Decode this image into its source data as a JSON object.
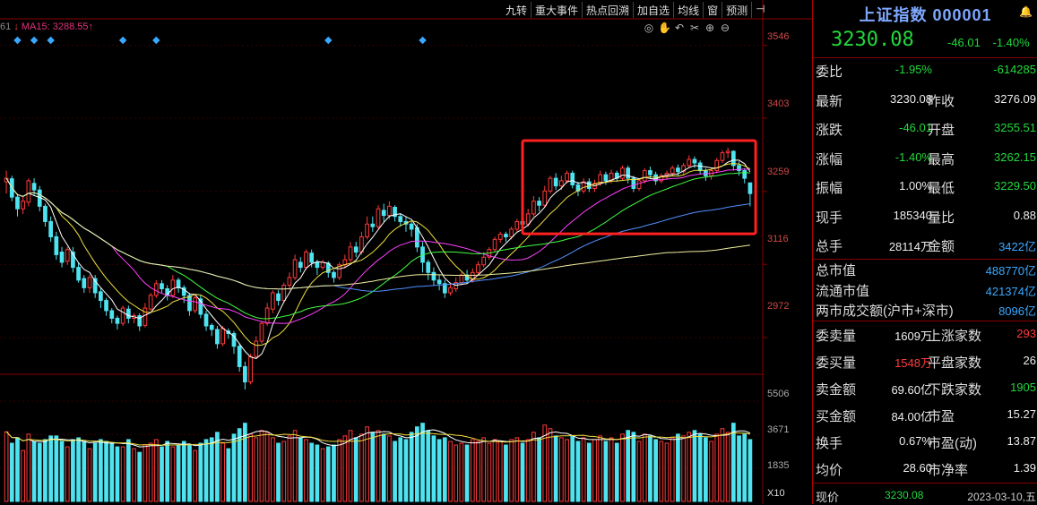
{
  "toolbar": [
    "九转",
    "重大事件",
    "热点回溯",
    "加自选",
    "均线",
    "窗",
    "预测",
    "⊣"
  ],
  "ma_legend": {
    "prefix": "61",
    "ma15": "MA15: 3288.55",
    "arrow": "↑"
  },
  "chart_tools": [
    "◎",
    "✋",
    "↶",
    "✂",
    "⊕",
    "⊖"
  ],
  "price_axis": [
    "3546",
    "3403",
    "3259",
    "3116",
    "2972"
  ],
  "volume_axis": [
    "5506",
    "3671",
    "1835"
  ],
  "volume_unit": "X10",
  "panel": {
    "name": "上证指数",
    "code": "000001",
    "price": "3230.08",
    "change": "-46.01",
    "change_pct": "-1.40%",
    "rows": [
      {
        "l1": "委比",
        "v1": "-1.95%",
        "c1": "g",
        "l2": "",
        "v2": "-614285",
        "c2": "g"
      },
      {
        "l1": "最新",
        "v1": "3230.08",
        "c1": "w",
        "l2": "昨收",
        "v2": "3276.09",
        "c2": "w"
      },
      {
        "l1": "涨跌",
        "v1": "-46.01",
        "c1": "g",
        "l2": "开盘",
        "v2": "3255.51",
        "c2": "g"
      },
      {
        "l1": "涨幅",
        "v1": "-1.40%",
        "c1": "g",
        "l2": "最高",
        "v2": "3262.15",
        "c2": "g"
      },
      {
        "l1": "振幅",
        "v1": "1.00%",
        "c1": "w",
        "l2": "最低",
        "v2": "3229.50",
        "c2": "g"
      },
      {
        "l1": "现手",
        "v1": "185340",
        "c1": "w",
        "l2": "量比",
        "v2": "0.88",
        "c2": "w"
      },
      {
        "l1": "总手",
        "v1": "28114万",
        "c1": "w",
        "l2": "金额",
        "v2": "3422亿",
        "c2": "b"
      }
    ],
    "market": [
      {
        "l": "总市值",
        "v": "488770亿"
      },
      {
        "l": "流通市值",
        "v": "421374亿"
      },
      {
        "l": "两市成交额(沪市+深市)",
        "v": "8096亿"
      }
    ],
    "rows2": [
      {
        "l1": "委卖量",
        "v1": "1609万",
        "c1": "w",
        "l2": "上涨家数",
        "v2": "293",
        "c2": "r"
      },
      {
        "l1": "委买量",
        "v1": "1548万",
        "c1": "r",
        "l2": "平盘家数",
        "v2": "26",
        "c2": "w"
      },
      {
        "l1": "卖金额",
        "v1": "69.60亿",
        "c1": "w",
        "l2": "下跌家数",
        "v2": "1905",
        "c2": "g"
      },
      {
        "l1": "买金额",
        "v1": "84.00亿",
        "c1": "w",
        "l2": "市盈",
        "v2": "15.27",
        "c2": "w"
      },
      {
        "l1": "换手",
        "v1": "0.67%",
        "c1": "w",
        "l2": "市盈(动)",
        "v2": "13.87",
        "c2": "w"
      },
      {
        "l1": "均价",
        "v1": "28.60",
        "c1": "w",
        "l2": "市净率",
        "v2": "1.39",
        "c2": "w"
      }
    ],
    "bottom": {
      "label": "现价",
      "price": "3230.08",
      "date": "2023-03-10,五"
    }
  },
  "chart_data": {
    "type": "candlestick",
    "y_axis_ticks": [
      3546,
      3403,
      3259,
      3116,
      2972
    ],
    "y_range": [
      2900,
      3600
    ],
    "volume_ticks": [
      5506,
      3671,
      1835
    ],
    "volume_range": [
      0,
      6400
    ],
    "candles": [
      [
        3278,
        3285,
        3255,
        3300,
        3830
      ],
      [
        3284,
        3248,
        3240,
        3290,
        3200
      ],
      [
        3248,
        3225,
        3210,
        3255,
        3500
      ],
      [
        3225,
        3240,
        3215,
        3250,
        2800
      ],
      [
        3238,
        3280,
        3230,
        3285,
        3700
      ],
      [
        3275,
        3262,
        3250,
        3285,
        3300
      ],
      [
        3262,
        3230,
        3220,
        3270,
        3200
      ],
      [
        3230,
        3200,
        3190,
        3235,
        3400
      ],
      [
        3200,
        3170,
        3160,
        3210,
        3600
      ],
      [
        3170,
        3135,
        3125,
        3180,
        3600
      ],
      [
        3140,
        3120,
        3110,
        3150,
        3300
      ],
      [
        3122,
        3145,
        3115,
        3150,
        3000
      ],
      [
        3140,
        3110,
        3100,
        3150,
        3400
      ],
      [
        3110,
        3085,
        3080,
        3120,
        3500
      ],
      [
        3088,
        3070,
        3060,
        3095,
        3300
      ],
      [
        3070,
        3090,
        3060,
        3095,
        2900
      ],
      [
        3088,
        3060,
        3050,
        3095,
        3200
      ],
      [
        3062,
        3045,
        3030,
        3070,
        3400
      ],
      [
        3045,
        3025,
        3015,
        3050,
        3300
      ],
      [
        3025,
        3010,
        3000,
        3030,
        3200
      ],
      [
        3010,
        3000,
        2988,
        3015,
        3000
      ],
      [
        3000,
        3030,
        2995,
        3035,
        3000
      ],
      [
        3028,
        3010,
        3000,
        3035,
        3400
      ],
      [
        3010,
        3015,
        3000,
        3020,
        2900
      ],
      [
        3015,
        2995,
        2985,
        3020,
        2700
      ],
      [
        2996,
        3030,
        2992,
        3040,
        3100
      ],
      [
        3028,
        3055,
        3025,
        3060,
        3200
      ],
      [
        3055,
        3078,
        3050,
        3085,
        3400
      ],
      [
        3078,
        3068,
        3060,
        3085,
        3000
      ],
      [
        3068,
        3055,
        3045,
        3075,
        3300
      ],
      [
        3055,
        3085,
        3050,
        3095,
        3000
      ],
      [
        3085,
        3070,
        3060,
        3090,
        3100
      ],
      [
        3070,
        3055,
        3040,
        3075,
        3300
      ],
      [
        3055,
        3025,
        3015,
        3060,
        3100
      ],
      [
        3025,
        3050,
        3020,
        3055,
        2800
      ],
      [
        3048,
        3018,
        3010,
        3055,
        3200
      ],
      [
        3018,
        2995,
        2985,
        3025,
        3400
      ],
      [
        2996,
        2988,
        2975,
        3000,
        3500
      ],
      [
        2988,
        2960,
        2950,
        2995,
        3800
      ],
      [
        2960,
        2990,
        2955,
        2995,
        3200
      ],
      [
        2985,
        2980,
        2970,
        2990,
        2900
      ],
      [
        2980,
        2955,
        2940,
        2985,
        3700
      ],
      [
        2955,
        2915,
        2905,
        2960,
        4000
      ],
      [
        2915,
        2885,
        2870,
        2925,
        4300
      ],
      [
        2885,
        2935,
        2880,
        2940,
        3700
      ],
      [
        2935,
        2965,
        2930,
        2975,
        3500
      ],
      [
        2965,
        3000,
        2960,
        3005,
        3900
      ],
      [
        3000,
        3030,
        2995,
        3040,
        3800
      ],
      [
        3028,
        3060,
        3020,
        3065,
        3500
      ],
      [
        3058,
        3045,
        3035,
        3065,
        3200
      ],
      [
        3045,
        3075,
        3040,
        3080,
        3300
      ],
      [
        3075,
        3090,
        3065,
        3100,
        3600
      ],
      [
        3090,
        3125,
        3085,
        3135,
        3900
      ],
      [
        3120,
        3110,
        3100,
        3130,
        3500
      ],
      [
        3110,
        3140,
        3105,
        3145,
        3400
      ],
      [
        3138,
        3120,
        3110,
        3145,
        3200
      ],
      [
        3120,
        3110,
        3095,
        3125,
        3100
      ],
      [
        3110,
        3120,
        3105,
        3125,
        2900
      ],
      [
        3118,
        3100,
        3090,
        3122,
        3000
      ],
      [
        3100,
        3090,
        3080,
        3105,
        3100
      ],
      [
        3090,
        3115,
        3085,
        3120,
        3400
      ],
      [
        3115,
        3125,
        3108,
        3135,
        3600
      ],
      [
        3125,
        3150,
        3120,
        3160,
        3900
      ],
      [
        3150,
        3140,
        3130,
        3160,
        3500
      ],
      [
        3140,
        3170,
        3135,
        3180,
        3700
      ],
      [
        3170,
        3195,
        3165,
        3210,
        4100
      ],
      [
        3195,
        3190,
        3180,
        3210,
        3800
      ],
      [
        3190,
        3225,
        3185,
        3232,
        3900
      ],
      [
        3222,
        3212,
        3200,
        3235,
        3700
      ],
      [
        3212,
        3230,
        3205,
        3240,
        3600
      ],
      [
        3228,
        3210,
        3200,
        3232,
        3300
      ],
      [
        3210,
        3200,
        3190,
        3215,
        3500
      ],
      [
        3200,
        3195,
        3180,
        3210,
        3400
      ],
      [
        3195,
        3185,
        3170,
        3200,
        3800
      ],
      [
        3188,
        3150,
        3140,
        3195,
        4100
      ],
      [
        3150,
        3120,
        3100,
        3160,
        4300
      ],
      [
        3120,
        3100,
        3085,
        3125,
        3900
      ],
      [
        3100,
        3085,
        3075,
        3110,
        3600
      ],
      [
        3085,
        3078,
        3065,
        3095,
        3400
      ],
      [
        3078,
        3060,
        3050,
        3085,
        3500
      ],
      [
        3060,
        3070,
        3055,
        3080,
        3300
      ],
      [
        3068,
        3080,
        3062,
        3090,
        3100
      ],
      [
        3080,
        3095,
        3075,
        3100,
        3200
      ],
      [
        3095,
        3085,
        3078,
        3105,
        3100
      ],
      [
        3085,
        3100,
        3080,
        3108,
        3400
      ],
      [
        3100,
        3115,
        3095,
        3122,
        3300
      ],
      [
        3115,
        3130,
        3110,
        3140,
        3500
      ],
      [
        3130,
        3145,
        3125,
        3150,
        3200
      ],
      [
        3145,
        3165,
        3140,
        3170,
        3400
      ],
      [
        3165,
        3175,
        3158,
        3180,
        3300
      ],
      [
        3175,
        3170,
        3160,
        3180,
        3100
      ],
      [
        3170,
        3185,
        3165,
        3190,
        3400
      ],
      [
        3185,
        3200,
        3180,
        3205,
        3500
      ],
      [
        3200,
        3195,
        3185,
        3205,
        3200
      ],
      [
        3195,
        3215,
        3190,
        3225,
        3400
      ],
      [
        3215,
        3240,
        3210,
        3250,
        3800
      ],
      [
        3240,
        3232,
        3220,
        3248,
        3500
      ],
      [
        3232,
        3260,
        3228,
        3270,
        4200
      ],
      [
        3260,
        3285,
        3255,
        3290,
        4000
      ],
      [
        3285,
        3270,
        3262,
        3295,
        3600
      ],
      [
        3270,
        3280,
        3262,
        3290,
        3500
      ],
      [
        3280,
        3295,
        3275,
        3300,
        3400
      ],
      [
        3295,
        3272,
        3265,
        3300,
        3600
      ],
      [
        3272,
        3260,
        3250,
        3278,
        3300
      ],
      [
        3260,
        3278,
        3255,
        3285,
        3500
      ],
      [
        3278,
        3265,
        3258,
        3285,
        3200
      ],
      [
        3265,
        3275,
        3258,
        3282,
        3400
      ],
      [
        3275,
        3292,
        3270,
        3300,
        3600
      ],
      [
        3292,
        3280,
        3272,
        3298,
        3300
      ],
      [
        3280,
        3295,
        3275,
        3302,
        3500
      ],
      [
        3295,
        3285,
        3278,
        3300,
        3200
      ],
      [
        3285,
        3305,
        3280,
        3310,
        3700
      ],
      [
        3305,
        3285,
        3275,
        3310,
        3900
      ],
      [
        3285,
        3265,
        3258,
        3290,
        3800
      ],
      [
        3265,
        3280,
        3260,
        3285,
        3300
      ],
      [
        3280,
        3300,
        3275,
        3305,
        3700
      ],
      [
        3300,
        3292,
        3285,
        3308,
        3600
      ],
      [
        3292,
        3280,
        3272,
        3298,
        3400
      ],
      [
        3280,
        3290,
        3275,
        3295,
        3300
      ],
      [
        3290,
        3295,
        3282,
        3300,
        3200
      ],
      [
        3295,
        3305,
        3290,
        3310,
        3500
      ],
      [
        3305,
        3298,
        3290,
        3312,
        3700
      ],
      [
        3298,
        3310,
        3292,
        3315,
        3600
      ],
      [
        3310,
        3322,
        3305,
        3330,
        3800
      ],
      [
        3322,
        3315,
        3305,
        3328,
        3900
      ],
      [
        3315,
        3300,
        3292,
        3320,
        3700
      ],
      [
        3300,
        3290,
        3280,
        3305,
        3500
      ],
      [
        3290,
        3300,
        3282,
        3306,
        3300
      ],
      [
        3300,
        3320,
        3295,
        3325,
        3700
      ],
      [
        3320,
        3335,
        3315,
        3340,
        4000
      ],
      [
        3335,
        3338,
        3325,
        3345,
        3800
      ],
      [
        3338,
        3310,
        3300,
        3340,
        4300
      ],
      [
        3310,
        3300,
        3290,
        3318,
        3600
      ],
      [
        3300,
        3285,
        3275,
        3305,
        3700
      ],
      [
        3276,
        3255,
        3230,
        3262,
        3400
      ]
    ],
    "highlight_box": {
      "from_index": 94,
      "to_index": 136
    }
  }
}
